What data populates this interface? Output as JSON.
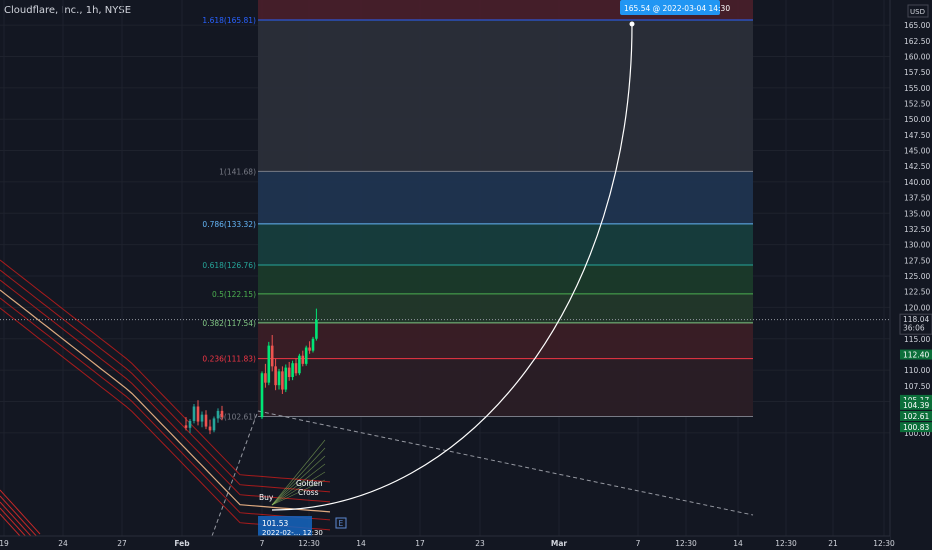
{
  "header": {
    "symbol_title": "Cloudflare, Inc., 1h, NYSE"
  },
  "price_axis": {
    "currency": "USD",
    "ticks": [
      165,
      162.5,
      160,
      157.5,
      155,
      152.5,
      150,
      147.5,
      145,
      142.5,
      140,
      137.5,
      135,
      132.5,
      130,
      127.5,
      125,
      122.5,
      120,
      117.5,
      115,
      112.5,
      110,
      107.5,
      105,
      102.5,
      100
    ]
  },
  "price_labels": [
    {
      "label": "118.04",
      "sub": "36:06",
      "price": 118.04,
      "color": "#131722",
      "text_color": "#d1d4dc",
      "outlined": true
    },
    {
      "label": "112.40",
      "price": 112.4,
      "color": "#0c6f3a",
      "text_color": "#ffffff"
    },
    {
      "label": "105.17",
      "price": 105.17,
      "color": "#0c6f3a",
      "text_color": "#ffffff"
    },
    {
      "label": "104.39",
      "price": 104.39,
      "color": "#0c6f3a",
      "text_color": "#ffffff"
    },
    {
      "label": "102.61",
      "price": 102.61,
      "color": "#0c6f3a",
      "text_color": "#ffffff"
    },
    {
      "label": "100.83",
      "price": 100.83,
      "color": "#0c6f3a",
      "text_color": "#ffffff"
    }
  ],
  "time_axis": {
    "ticks": [
      {
        "label": "19",
        "bold": false
      },
      {
        "label": "24",
        "bold": false
      },
      {
        "label": "27",
        "bold": false
      },
      {
        "label": "Feb",
        "bold": true
      },
      {
        "label": "7",
        "bold": false
      },
      {
        "label": "12:30",
        "bold": false
      },
      {
        "label": "14",
        "bold": false
      },
      {
        "label": "17",
        "bold": false
      },
      {
        "label": "23",
        "bold": false
      },
      {
        "label": "Mar",
        "bold": true
      },
      {
        "label": "7",
        "bold": false
      },
      {
        "label": "12:30",
        "bold": false
      },
      {
        "label": "14",
        "bold": false
      },
      {
        "label": "12:30",
        "bold": false
      },
      {
        "label": "21",
        "bold": false
      },
      {
        "label": "12:30",
        "bold": false
      }
    ]
  },
  "fib_levels": [
    {
      "label": "1.618(165.81)",
      "ratio": 1.618,
      "price": 165.81,
      "color": "#2962ff",
      "zone_color": "#1e3a8a"
    },
    {
      "label": "1(141.68)",
      "ratio": 1,
      "price": 141.68,
      "color": "#787b86",
      "zone_color": "#2a2e39"
    },
    {
      "label": "0.786(133.32)",
      "ratio": 0.786,
      "price": 133.32,
      "color": "#64b5f6",
      "zone_color": "#1f3450"
    },
    {
      "label": "0.618(126.76)",
      "ratio": 0.618,
      "price": 126.76,
      "color": "#26a69a",
      "zone_color": "#163d3d"
    },
    {
      "label": "0.5(122.15)",
      "ratio": 0.5,
      "price": 122.15,
      "color": "#4caf50",
      "zone_color": "#1a3a2a"
    },
    {
      "label": "0.382(117.54)",
      "ratio": 0.382,
      "price": 117.54,
      "color": "#81c784",
      "zone_color": "#22382a"
    },
    {
      "label": "0.236(111.83)",
      "ratio": 0.236,
      "price": 111.83,
      "color": "#f23645",
      "zone_color": "#3a1e26"
    },
    {
      "label": "0(102.61)",
      "ratio": 0,
      "price": 102.61,
      "color": "#787b86",
      "zone_color": "#2a1e26"
    }
  ],
  "projection": {
    "label": "165.54 @ 2022-03-04  14:30",
    "price": 165.54,
    "color": "#2196f3"
  },
  "annotations": {
    "buy": "Buy",
    "golden_cross": [
      "Golden",
      "Cross"
    ],
    "tooltip_line1": "101.53",
    "tooltip_line2": "2022-02-... 12:30",
    "marker": "E"
  },
  "colors": {
    "background": "#131722",
    "up_candle": "#26a69a",
    "bright_up": "#00e676",
    "down_candle": "#ef5350",
    "text": "#d1d4dc",
    "grid": "#1e222d"
  },
  "chart_data": {
    "type": "candlestick",
    "title": "Cloudflare, Inc., 1h, NYSE",
    "ylabel": "USD",
    "ylim": [
      99,
      167.5
    ],
    "last_price": 118.04,
    "fib_levels": [
      {
        "ratio": 0,
        "price": 102.61
      },
      {
        "ratio": 0.236,
        "price": 111.83
      },
      {
        "ratio": 0.382,
        "price": 117.54
      },
      {
        "ratio": 0.5,
        "price": 122.15
      },
      {
        "ratio": 0.618,
        "price": 126.76
      },
      {
        "ratio": 0.786,
        "price": 133.32
      },
      {
        "ratio": 1,
        "price": 141.68
      },
      {
        "ratio": 1.618,
        "price": 165.81
      }
    ],
    "projected_target": {
      "price": 165.54,
      "time": "2022-03-04 14:30"
    },
    "candles": [
      {
        "o": 101.2,
        "h": 102.5,
        "l": 100.4,
        "c": 100.8
      },
      {
        "o": 100.8,
        "h": 102.2,
        "l": 100.0,
        "c": 101.9
      },
      {
        "o": 101.9,
        "h": 104.6,
        "l": 101.5,
        "c": 104.2
      },
      {
        "o": 104.2,
        "h": 105.2,
        "l": 101.2,
        "c": 101.8
      },
      {
        "o": 101.8,
        "h": 103.4,
        "l": 100.9,
        "c": 102.9
      },
      {
        "o": 102.9,
        "h": 103.6,
        "l": 100.6,
        "c": 101.0
      },
      {
        "o": 101.0,
        "h": 102.1,
        "l": 99.8,
        "c": 100.4
      },
      {
        "o": 100.4,
        "h": 102.6,
        "l": 100.1,
        "c": 102.3
      },
      {
        "o": 102.3,
        "h": 103.9,
        "l": 101.6,
        "c": 103.5
      },
      {
        "o": 103.5,
        "h": 104.3,
        "l": 102.0,
        "c": 102.5
      },
      {
        "o": 102.5,
        "h": 109.8,
        "l": 102.2,
        "c": 109.5
      },
      {
        "o": 109.5,
        "h": 111.0,
        "l": 107.2,
        "c": 108.0
      },
      {
        "o": 108.0,
        "h": 114.5,
        "l": 107.6,
        "c": 113.9
      },
      {
        "o": 113.9,
        "h": 115.6,
        "l": 109.8,
        "c": 110.6
      },
      {
        "o": 110.6,
        "h": 111.8,
        "l": 106.8,
        "c": 107.6
      },
      {
        "o": 107.6,
        "h": 110.2,
        "l": 106.9,
        "c": 109.8
      },
      {
        "o": 109.8,
        "h": 110.6,
        "l": 106.2,
        "c": 106.9
      },
      {
        "o": 106.9,
        "h": 110.9,
        "l": 106.5,
        "c": 110.4
      },
      {
        "o": 110.4,
        "h": 111.3,
        "l": 108.3,
        "c": 108.9
      },
      {
        "o": 108.9,
        "h": 111.5,
        "l": 108.4,
        "c": 111.1
      },
      {
        "o": 111.1,
        "h": 111.9,
        "l": 109.1,
        "c": 109.5
      },
      {
        "o": 109.5,
        "h": 112.6,
        "l": 109.2,
        "c": 112.3
      },
      {
        "o": 112.3,
        "h": 113.1,
        "l": 110.6,
        "c": 111.0
      },
      {
        "o": 111.0,
        "h": 113.9,
        "l": 110.7,
        "c": 113.6
      },
      {
        "o": 113.6,
        "h": 114.6,
        "l": 112.6,
        "c": 113.1
      },
      {
        "o": 113.1,
        "h": 115.3,
        "l": 112.8,
        "c": 115.0
      },
      {
        "o": 115.0,
        "h": 119.8,
        "l": 114.7,
        "c": 118.04
      }
    ]
  }
}
